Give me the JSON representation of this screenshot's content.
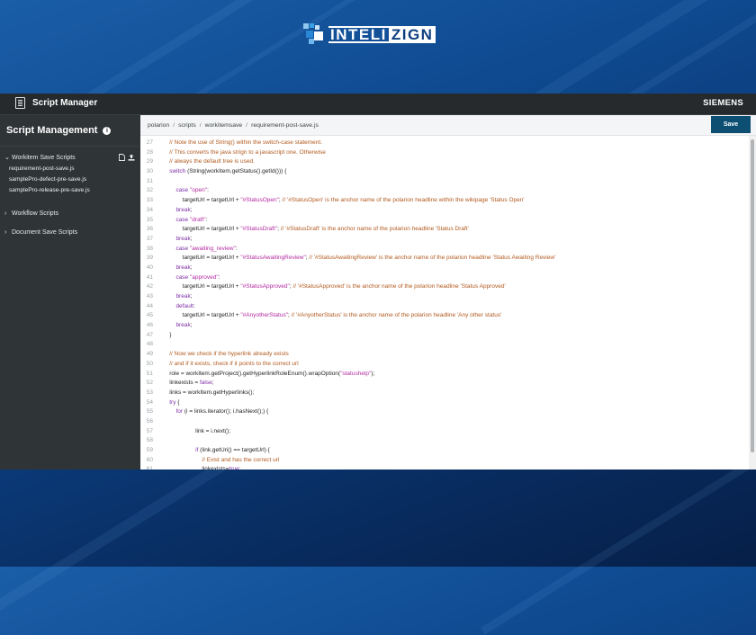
{
  "brand": {
    "logo_text_1": "INTELI",
    "logo_text_2": "ZIGN",
    "vendor": "SIEMENS"
  },
  "app": {
    "title": "Script Manager"
  },
  "sidebar": {
    "heading": "Script Management",
    "groups": [
      {
        "label": "Workitem Save Scripts",
        "expanded": true,
        "items": [
          "requirement-post-save.js",
          "samplePro-defect-pre-save.js",
          "samplePro-release-pre-save.js"
        ]
      },
      {
        "label": "Workflow Scripts",
        "expanded": false,
        "items": []
      },
      {
        "label": "Document Save Scripts",
        "expanded": false,
        "items": []
      }
    ]
  },
  "breadcrumb": [
    "polarion",
    "scripts",
    "workitemsave",
    "requirement-post-save.js"
  ],
  "toolbar": {
    "save_label": "Save"
  },
  "editor": {
    "lines": [
      {
        "n": "27",
        "segs": [
          [
            "c",
            "    // Note the use of String() within the switch-case statement."
          ]
        ]
      },
      {
        "n": "28",
        "segs": [
          [
            "c",
            "    // This converts the java strign to a javascript one. Otherwise"
          ]
        ]
      },
      {
        "n": "29",
        "segs": [
          [
            "c",
            "    // always the default tree is used."
          ]
        ]
      },
      {
        "n": "30",
        "segs": [
          [
            "k",
            "    switch"
          ],
          [
            "t",
            " (String(workItem.getStatus().getId())) {"
          ]
        ]
      },
      {
        "n": "31",
        "segs": []
      },
      {
        "n": "32",
        "segs": [
          [
            "k",
            "        case "
          ],
          [
            "s",
            "\"open\""
          ],
          [
            "t",
            ":"
          ]
        ]
      },
      {
        "n": "33",
        "segs": [
          [
            "t",
            "            targetUrl = targetUrl + "
          ],
          [
            "s",
            "\"#StatusOpen\""
          ],
          [
            "t",
            "; "
          ],
          [
            "c",
            "// '#StatusOpen' is the anchor name of the polarion headline within the wikipage 'Status Open'"
          ]
        ]
      },
      {
        "n": "34",
        "segs": [
          [
            "k",
            "        break"
          ],
          [
            "t",
            ";"
          ]
        ]
      },
      {
        "n": "35",
        "segs": [
          [
            "k",
            "        case "
          ],
          [
            "s",
            "\"draft\""
          ],
          [
            "t",
            ":"
          ]
        ]
      },
      {
        "n": "36",
        "segs": [
          [
            "t",
            "            targetUrl = targetUrl + "
          ],
          [
            "s",
            "\"#StatusDraft\""
          ],
          [
            "t",
            "; "
          ],
          [
            "c",
            "// '#StatusDraft' is the anchor name of the polarion headline 'Status Draft'"
          ]
        ]
      },
      {
        "n": "37",
        "segs": [
          [
            "k",
            "        break"
          ],
          [
            "t",
            ";"
          ]
        ]
      },
      {
        "n": "38",
        "segs": [
          [
            "k",
            "        case "
          ],
          [
            "s",
            "\"awaiting_review\""
          ],
          [
            "t",
            ":"
          ]
        ]
      },
      {
        "n": "39",
        "segs": [
          [
            "t",
            "            targetUrl = targetUrl + "
          ],
          [
            "s",
            "\"#StatusAwaitingReview\""
          ],
          [
            "t",
            "; "
          ],
          [
            "c",
            "// '#StatusAwaitingReview' is the anchor name of the polarion headline 'Status Awaiting Review'"
          ]
        ]
      },
      {
        "n": "40",
        "segs": [
          [
            "k",
            "        break"
          ],
          [
            "t",
            ";"
          ]
        ]
      },
      {
        "n": "41",
        "segs": [
          [
            "k",
            "        case "
          ],
          [
            "s",
            "\"approved\""
          ],
          [
            "t",
            ":"
          ]
        ]
      },
      {
        "n": "42",
        "segs": [
          [
            "t",
            "            targetUrl = targetUrl + "
          ],
          [
            "s",
            "\"#StatusApproved\""
          ],
          [
            "t",
            "; "
          ],
          [
            "c",
            "// '#StatusApproved' is the anchor name of the polarion headline 'Status Approved'"
          ]
        ]
      },
      {
        "n": "43",
        "segs": [
          [
            "k",
            "        break"
          ],
          [
            "t",
            ";"
          ]
        ]
      },
      {
        "n": "44",
        "segs": [
          [
            "k",
            "        default"
          ],
          [
            "t",
            ":"
          ]
        ]
      },
      {
        "n": "45",
        "segs": [
          [
            "t",
            "            targetUrl = targetUrl + "
          ],
          [
            "s",
            "\"#AnyotherStatus\""
          ],
          [
            "t",
            "; "
          ],
          [
            "c",
            "// '#AnyotherStatus' is the anchor name of the polarion headline 'Any other status'"
          ]
        ]
      },
      {
        "n": "46",
        "segs": [
          [
            "k",
            "        break"
          ],
          [
            "t",
            ";"
          ]
        ]
      },
      {
        "n": "47",
        "segs": [
          [
            "t",
            "    }"
          ]
        ]
      },
      {
        "n": "48",
        "segs": []
      },
      {
        "n": "49",
        "segs": [
          [
            "c",
            "    // Now we check if the hyperlink already exists"
          ]
        ]
      },
      {
        "n": "50",
        "segs": [
          [
            "c",
            "    // and if it exists, check if it points to the correct url"
          ]
        ]
      },
      {
        "n": "51",
        "segs": [
          [
            "t",
            "    role = workItem.getProject().getHyperlinkRoleEnum().wrapOption("
          ],
          [
            "s",
            "\"statushelp\""
          ],
          [
            "t",
            ");"
          ]
        ]
      },
      {
        "n": "52",
        "segs": [
          [
            "t",
            "    linkexists = "
          ],
          [
            "k",
            "false"
          ],
          [
            "t",
            ";"
          ]
        ]
      },
      {
        "n": "53",
        "segs": [
          [
            "t",
            "    links = workItem.getHyperlinks();"
          ]
        ]
      },
      {
        "n": "54",
        "segs": [
          [
            "k",
            "    try"
          ],
          [
            "t",
            " {"
          ]
        ]
      },
      {
        "n": "55",
        "segs": [
          [
            "k",
            "        for"
          ],
          [
            "t",
            " (i = links.iterator(); i.hasNext();) {"
          ]
        ]
      },
      {
        "n": "56",
        "segs": []
      },
      {
        "n": "57",
        "segs": [
          [
            "t",
            "                    link = i.next();"
          ]
        ]
      },
      {
        "n": "58",
        "segs": []
      },
      {
        "n": "59",
        "segs": [
          [
            "k",
            "                    if"
          ],
          [
            "t",
            " (link.getUri() == targetUrl) {"
          ]
        ]
      },
      {
        "n": "60",
        "segs": [
          [
            "c",
            "                        // Exist and has the correct url"
          ]
        ]
      },
      {
        "n": "61",
        "segs": [
          [
            "t",
            "                        linkexists="
          ],
          [
            "k",
            "true"
          ],
          [
            "t",
            ";"
          ]
        ]
      }
    ]
  }
}
